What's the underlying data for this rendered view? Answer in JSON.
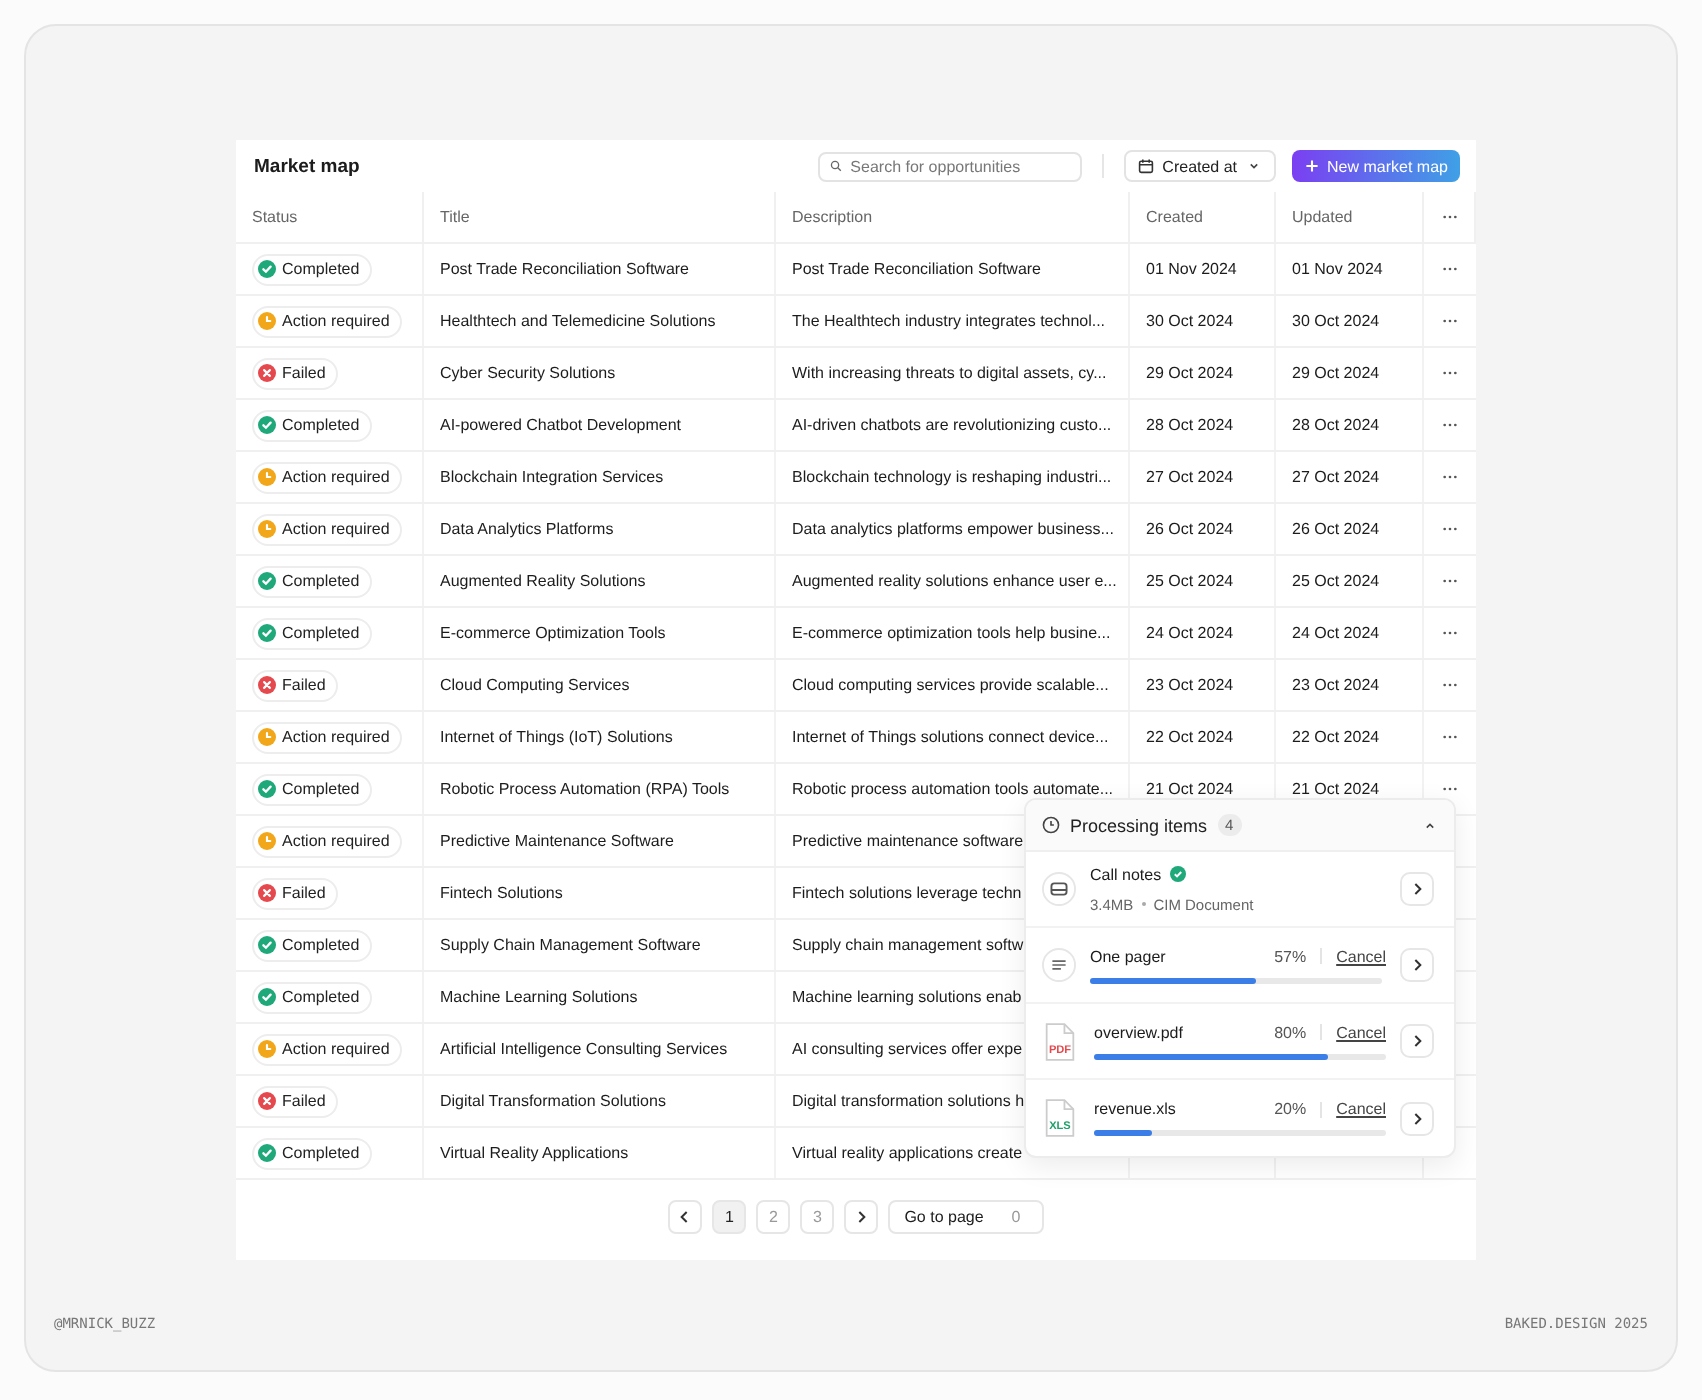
{
  "header": {
    "title": "Market map",
    "search": {
      "placeholder": "Search for opportunities"
    },
    "sort_button": "Created at",
    "new_button": "New market map"
  },
  "table": {
    "columns": [
      "Status",
      "Title",
      "Description",
      "Created",
      "Updated"
    ],
    "rows": [
      {
        "kind": "check",
        "color": "#1fa87a",
        "status": "Completed",
        "title": "Post Trade Reconciliation Software",
        "description": "Post Trade Reconciliation Software",
        "created": "01 Nov 2024",
        "updated": "01 Nov 2024"
      },
      {
        "kind": "clock",
        "color": "#f2a71b",
        "status": "Action required",
        "title": "Healthtech and Telemedicine Solutions",
        "description": "The Healthtech industry integrates technol...",
        "created": "30 Oct 2024",
        "updated": "30 Oct 2024"
      },
      {
        "kind": "cross",
        "color": "#e5484d",
        "status": "Failed",
        "title": "Cyber Security Solutions",
        "description": "With increasing threats to digital assets, cy...",
        "created": "29 Oct 2024",
        "updated": "29 Oct 2024"
      },
      {
        "kind": "check",
        "color": "#1fa87a",
        "status": "Completed",
        "title": "AI-powered Chatbot Development",
        "description": "AI-driven chatbots are revolutionizing custo...",
        "created": "28 Oct 2024",
        "updated": "28 Oct 2024"
      },
      {
        "kind": "clock",
        "color": "#f2a71b",
        "status": "Action required",
        "title": "Blockchain Integration Services",
        "description": "Blockchain technology is reshaping industri...",
        "created": "27 Oct 2024",
        "updated": "27 Oct 2024"
      },
      {
        "kind": "clock",
        "color": "#f2a71b",
        "status": "Action required",
        "title": "Data Analytics Platforms",
        "description": "Data analytics platforms empower business...",
        "created": "26 Oct 2024",
        "updated": "26 Oct 2024"
      },
      {
        "kind": "check",
        "color": "#1fa87a",
        "status": "Completed",
        "title": "Augmented Reality Solutions",
        "description": "Augmented reality solutions enhance user e...",
        "created": "25 Oct 2024",
        "updated": "25 Oct 2024"
      },
      {
        "kind": "check",
        "color": "#1fa87a",
        "status": "Completed",
        "title": "E-commerce Optimization Tools",
        "description": "E-commerce optimization tools help busine...",
        "created": "24 Oct 2024",
        "updated": "24 Oct 2024"
      },
      {
        "kind": "cross",
        "color": "#e5484d",
        "status": "Failed",
        "title": "Cloud Computing Services",
        "description": "Cloud computing services provide scalable...",
        "created": "23 Oct 2024",
        "updated": "23 Oct 2024"
      },
      {
        "kind": "clock",
        "color": "#f2a71b",
        "status": "Action required",
        "title": "Internet of Things (IoT) Solutions",
        "description": "Internet of Things solutions connect device...",
        "created": "22 Oct 2024",
        "updated": "22 Oct 2024"
      },
      {
        "kind": "check",
        "color": "#1fa87a",
        "status": "Completed",
        "title": "Robotic Process Automation (RPA) Tools",
        "description": "Robotic process automation tools automate...",
        "created": "21 Oct 2024",
        "updated": "21 Oct 2024"
      },
      {
        "kind": "clock",
        "color": "#f2a71b",
        "status": "Action required",
        "title": "Predictive Maintenance Software",
        "description": "Predictive maintenance software"
      },
      {
        "kind": "cross",
        "color": "#e5484d",
        "status": "Failed",
        "title": "Fintech Solutions",
        "description": "Fintech solutions leverage techn"
      },
      {
        "kind": "check",
        "color": "#1fa87a",
        "status": "Completed",
        "title": "Supply Chain Management Software",
        "description": "Supply chain management softw"
      },
      {
        "kind": "check",
        "color": "#1fa87a",
        "status": "Completed",
        "title": "Machine Learning Solutions",
        "description": "Machine learning solutions enab"
      },
      {
        "kind": "clock",
        "color": "#f2a71b",
        "status": "Action required",
        "title": "Artificial Intelligence Consulting Services",
        "description": "AI consulting services offer expe"
      },
      {
        "kind": "cross",
        "color": "#e5484d",
        "status": "Failed",
        "title": "Digital Transformation Solutions",
        "description": "Digital transformation solutions h"
      },
      {
        "kind": "check",
        "color": "#1fa87a",
        "status": "Completed",
        "title": "Virtual Reality Applications",
        "description": "Virtual reality applications create"
      }
    ]
  },
  "pagination": {
    "pages": [
      {
        "label": "1",
        "selected": true
      },
      {
        "label": "2",
        "selected": false
      },
      {
        "label": "3",
        "selected": false
      }
    ],
    "goto_label": "Go to page",
    "goto_value": "0"
  },
  "processing": {
    "title": "Processing items",
    "count": "4",
    "expanded": true,
    "items": [
      {
        "kind": "note",
        "name": "Call notes",
        "done": true,
        "meta": [
          "3.4MB",
          "CIM Document"
        ]
      },
      {
        "kind": "page",
        "name": "One pager",
        "percent": "57%",
        "level": 0.57,
        "action": "Cancel"
      },
      {
        "kind": "file",
        "badge": "PDF",
        "color": "#e5484d",
        "name": "overview.pdf",
        "percent": "80%",
        "level": 0.8,
        "action": "Cancel"
      },
      {
        "kind": "file",
        "badge": "XLS",
        "color": "#22a06b",
        "name": "revenue.xls",
        "percent": "20%",
        "level": 0.2,
        "action": "Cancel"
      }
    ]
  },
  "footer": {
    "left": "@MRNICK_BUZZ",
    "right": "BAKED.DESIGN 2025"
  }
}
